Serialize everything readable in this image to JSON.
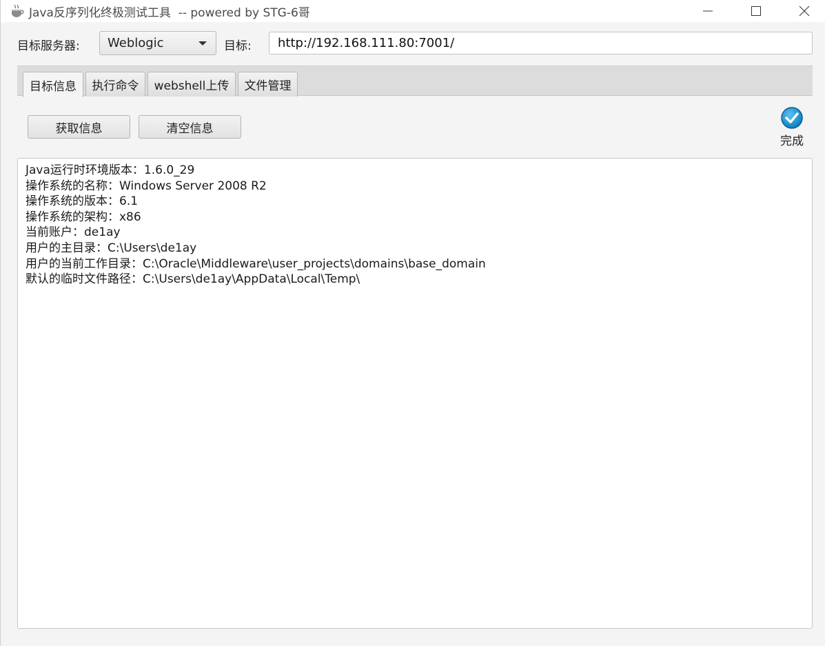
{
  "window": {
    "title": "Java反序列化终极测试工具  -- powered by STG-6哥"
  },
  "toolbar": {
    "server_label": "目标服务器:",
    "server_selected": "Weblogic",
    "target_label": "目标:",
    "target_value": "http://192.168.111.80:7001/"
  },
  "tabs": [
    {
      "label": "目标信息",
      "active": true
    },
    {
      "label": "执行命令",
      "active": false
    },
    {
      "label": "webshell上传",
      "active": false
    },
    {
      "label": "文件管理",
      "active": false
    }
  ],
  "actions": {
    "fetch_label": "获取信息",
    "clear_label": "清空信息"
  },
  "status": {
    "text": "完成",
    "icon": "check-circle-icon",
    "color": "#1a8fd0"
  },
  "output": {
    "lines": [
      "Java运行时环境版本：1.6.0_29",
      "操作系统的名称：Windows Server 2008 R2",
      "操作系统的版本：6.1",
      "操作系统的架构：x86",
      "当前账户：de1ay",
      "用户的主目录：C:\\Users\\de1ay",
      "用户的当前工作目录：C:\\Oracle\\Middleware\\user_projects\\domains\\base_domain",
      "默认的临时文件路径：C:\\Users\\de1ay\\AppData\\Local\\Temp\\"
    ]
  }
}
